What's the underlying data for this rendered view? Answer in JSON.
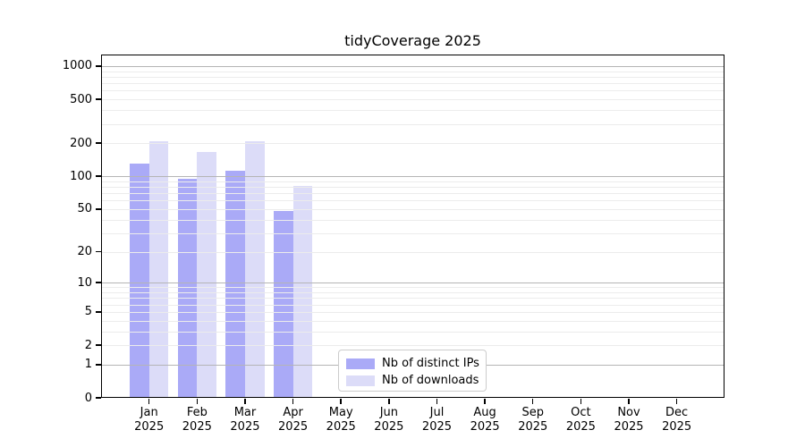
{
  "chart_data": {
    "type": "bar",
    "title": "tidyCoverage 2025",
    "months": [
      "Jan",
      "Feb",
      "Mar",
      "Apr",
      "May",
      "Jun",
      "Jul",
      "Aug",
      "Sep",
      "Oct",
      "Nov",
      "Dec"
    ],
    "year": "2025",
    "categories": [
      "Jan 2025",
      "Feb 2025",
      "Mar 2025",
      "Apr 2025",
      "May 2025",
      "Jun 2025",
      "Jul 2025",
      "Aug 2025",
      "Sep 2025",
      "Oct 2025",
      "Nov 2025",
      "Dec 2025"
    ],
    "series": [
      {
        "name": "Nb of distinct IPs",
        "color": "#aaaaf7",
        "values": [
          130,
          95,
          113,
          48,
          0,
          0,
          0,
          0,
          0,
          0,
          0,
          0
        ]
      },
      {
        "name": "Nb of downloads",
        "color": "#dcdcf8",
        "values": [
          210,
          167,
          210,
          82,
          0,
          0,
          0,
          0,
          0,
          0,
          0,
          0
        ]
      }
    ],
    "y_scale": "log1p",
    "y_ticks": [
      0,
      1,
      2,
      5,
      10,
      20,
      50,
      100,
      200,
      500,
      1000
    ],
    "y_minor_gridlines": [
      2,
      3,
      4,
      5,
      6,
      7,
      8,
      9,
      20,
      30,
      40,
      50,
      60,
      70,
      80,
      90,
      200,
      300,
      400,
      500,
      600,
      700,
      800,
      900
    ],
    "y_major_gridlines": [
      1,
      10,
      100,
      1000
    ],
    "ylim": [
      0,
      1250
    ],
    "xlabel": "",
    "ylabel": "",
    "grid": "horizontal",
    "legend_position": "lower center"
  },
  "colors": {
    "major_grid": "#b5b5b5",
    "minor_grid": "#ececec",
    "axis": "#000000",
    "background": "#ffffff"
  }
}
